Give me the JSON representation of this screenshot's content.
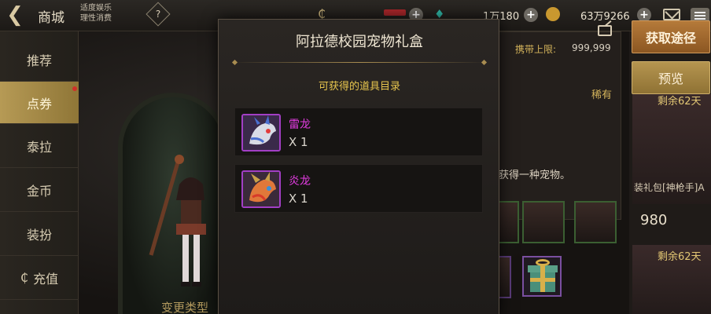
{
  "topbar": {
    "title": "商城",
    "advisory_line1": "适度娱乐",
    "advisory_line2": "理性消费",
    "help_label": "?",
    "currency1": "1万180",
    "currency2": "63万9266",
    "icons": [
      "back-arrow-icon",
      "help-icon",
      "ticket-icon",
      "gem-icon",
      "gold-coin-icon",
      "mail-icon",
      "menu-icon"
    ]
  },
  "sidebar": {
    "items": [
      {
        "label": "推荐",
        "active": false
      },
      {
        "label": "点券",
        "active": true
      },
      {
        "label": "泰拉",
        "active": false
      },
      {
        "label": "金币",
        "active": false
      },
      {
        "label": "装扮",
        "active": false
      },
      {
        "label": "充值",
        "active": false
      }
    ]
  },
  "background": {
    "change_type_label": "变更类型",
    "carry_limit_label": "携带上限:",
    "carry_limit_value": "999,999",
    "rarity_label": "稀有",
    "description": "获得一种宠物。"
  },
  "right_panel": {
    "source_button": "获取途径",
    "preview_button": "预览",
    "remain_1": "剩余62天",
    "remain_2": "剩余62天",
    "pack_name": "装礼包[神枪手]A",
    "pack_price": "980"
  },
  "modal": {
    "title": "阿拉德校园宠物礼盒",
    "subtitle": "可获得的道具目录",
    "items": [
      {
        "name": "雷龙",
        "count": "X 1",
        "icon": "thunder-dragon-icon"
      },
      {
        "name": "炎龙",
        "count": "X 1",
        "icon": "flame-dragon-icon"
      }
    ]
  },
  "colors": {
    "accent_gold": "#e8c64e",
    "item_name_purple": "#e23ce0",
    "sidebar_active": "#b69a55",
    "source_button": "#b57a3a"
  }
}
